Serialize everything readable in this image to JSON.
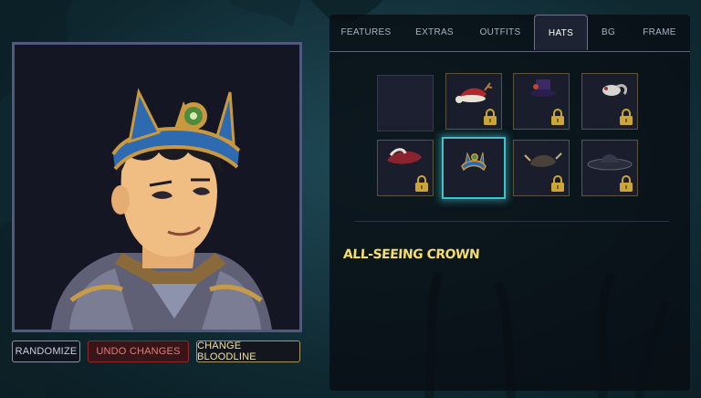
{
  "actions": {
    "randomize_label": "RANDOMIZE",
    "undo_label": "UNDO CHANGES",
    "bloodline_label": "CHANGE BLOODLINE"
  },
  "tabs": [
    {
      "label": "FEATURES",
      "active": false
    },
    {
      "label": "EXTRAS",
      "active": false
    },
    {
      "label": "OUTFITS",
      "active": false
    },
    {
      "label": "HATS",
      "active": true
    },
    {
      "label": "BG",
      "active": false
    },
    {
      "label": "FRAME",
      "active": false
    }
  ],
  "hats": [
    {
      "icon": "empty-slot",
      "locked": false,
      "selected": false
    },
    {
      "icon": "santa-antler-hat-icon",
      "locked": true,
      "selected": false
    },
    {
      "icon": "purple-top-hat-icon",
      "locked": true,
      "selected": false
    },
    {
      "icon": "feather-cap-icon",
      "locked": true,
      "selected": false
    },
    {
      "icon": "red-feather-hat-icon",
      "locked": true,
      "selected": false
    },
    {
      "icon": "all-seeing-crown-icon",
      "locked": false,
      "selected": true
    },
    {
      "icon": "horned-helmet-icon",
      "locked": true,
      "selected": false
    },
    {
      "icon": "wide-brim-hat-icon",
      "locked": true,
      "selected": false
    }
  ],
  "selected_item_name": "All-Seeing Crown",
  "colors": {
    "accent_selected": "#41c2c9",
    "item_name": "#f4dd6b",
    "undo": "#e07b7b",
    "lock": "#c9a53a"
  }
}
